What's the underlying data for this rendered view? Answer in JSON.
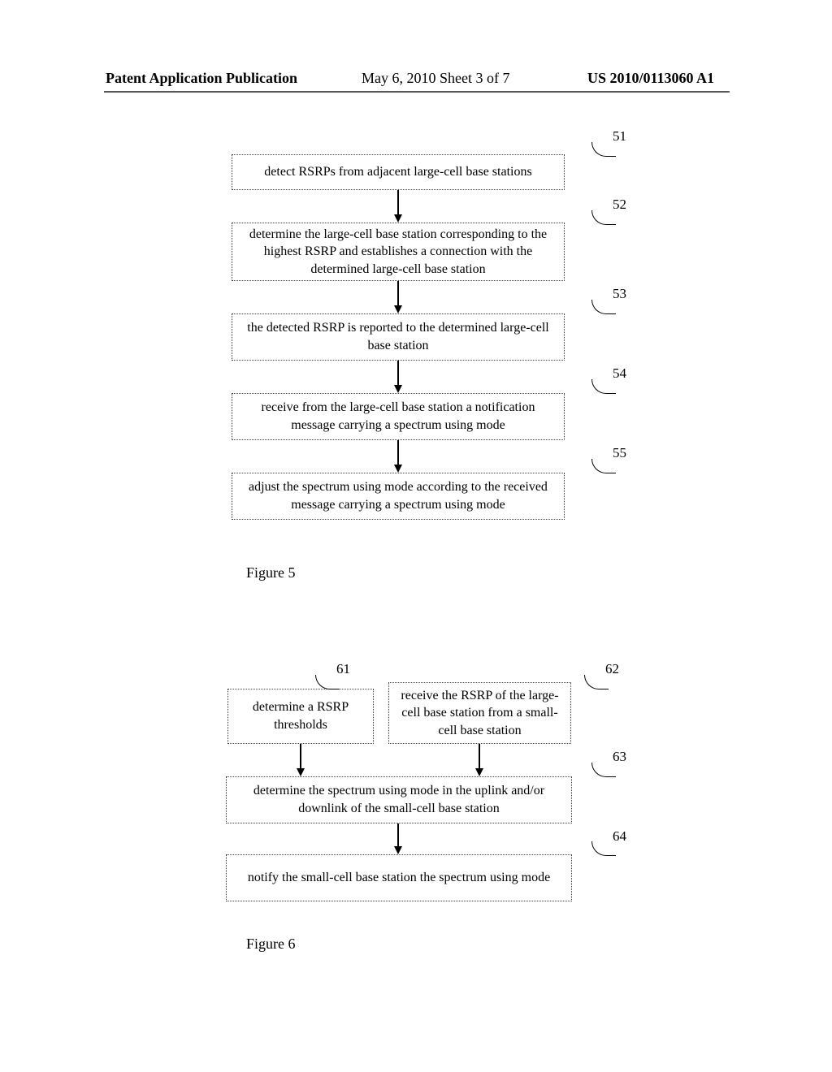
{
  "header": {
    "left": "Patent Application Publication",
    "center": "May 6, 2010  Sheet 3 of 7",
    "right": "US 2010/0113060 A1"
  },
  "fig5": {
    "caption": "Figure 5",
    "boxes": [
      {
        "ref": "51",
        "text": "detect RSRPs from adjacent large-cell base stations"
      },
      {
        "ref": "52",
        "text": "determine the large-cell base station corresponding to the highest RSRP and establishes a connection with the determined large-cell base station"
      },
      {
        "ref": "53",
        "text": "the detected RSRP is reported to the determined large-cell base station"
      },
      {
        "ref": "54",
        "text": "receive from the large-cell base station a notification message carrying a spectrum using mode"
      },
      {
        "ref": "55",
        "text": "adjust the spectrum using mode according to the received message carrying a spectrum using mode"
      }
    ]
  },
  "fig6": {
    "caption": "Figure 6",
    "boxes": [
      {
        "ref": "61",
        "text": "determine a RSRP thresholds"
      },
      {
        "ref": "62",
        "text": "receive the RSRP of the large-cell base station from a small-cell base station"
      },
      {
        "ref": "63",
        "text": "determine the spectrum using mode in the uplink and/or downlink of the small-cell base station"
      },
      {
        "ref": "64",
        "text": "notify the small-cell base station the spectrum using mode"
      }
    ]
  }
}
